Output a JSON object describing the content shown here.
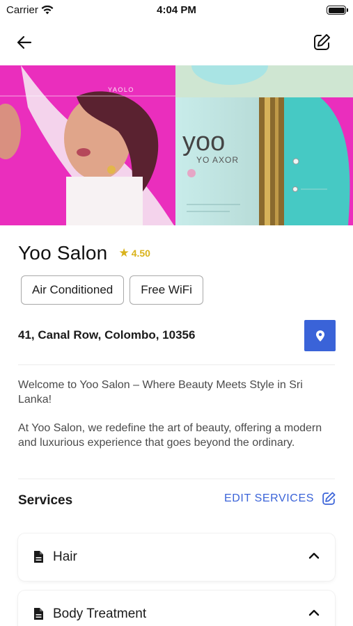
{
  "status_bar": {
    "carrier": "Carrier",
    "time": "4:04 PM"
  },
  "hero": {
    "brand_small": "YAOLO",
    "brand_large": "yoo",
    "brand_sub": "YO AXOR"
  },
  "salon": {
    "name": "Yoo Salon",
    "rating": "4.50"
  },
  "features": [
    "Air Conditioned",
    "Free WiFi"
  ],
  "address": "41, Canal Row, Colombo, 10356",
  "description": {
    "p1": "Welcome to Yoo Salon – Where Beauty Meets Style in Sri Lanka!",
    "p2": "At Yoo Salon, we redefine the art of beauty, offering a modern and luxurious experience that goes beyond the ordinary."
  },
  "services": {
    "title": "Services",
    "edit_label": "EDIT SERVICES",
    "items": [
      {
        "label": "Hair"
      },
      {
        "label": "Body Treatment"
      }
    ]
  },
  "colors": {
    "accent": "#3a63d8",
    "rating": "#d9b21b",
    "hero_magenta": "#e91fb7",
    "hero_teal": "#46c9c4"
  },
  "icons": [
    "wifi-icon",
    "battery-icon",
    "back-arrow-icon",
    "edit-icon",
    "star-icon",
    "location-pin-icon",
    "document-icon",
    "chevron-up-icon"
  ]
}
